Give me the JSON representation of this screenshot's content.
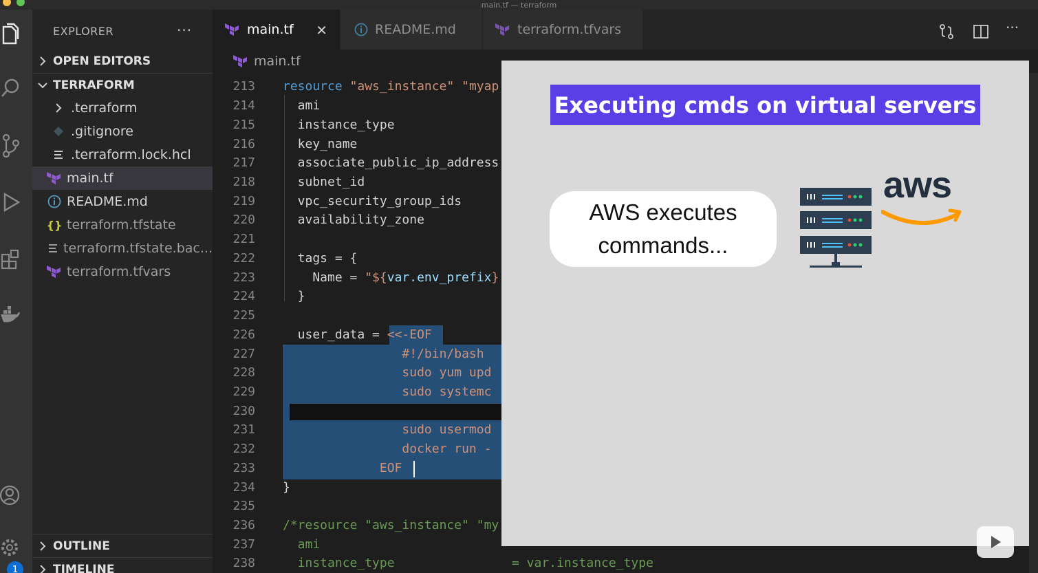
{
  "window": {
    "title": "main.tf — terraform"
  },
  "sidebar": {
    "header": "EXPLORER",
    "more": "···",
    "open_editors": "OPEN EDITORS",
    "folder": "TERRAFORM",
    "items": [
      {
        "label": ".terraform",
        "icon": "chevron-right-icon"
      },
      {
        "label": ".gitignore",
        "icon": "git-diamond-icon"
      },
      {
        "label": ".terraform.lock.hcl",
        "icon": "lines-icon"
      },
      {
        "label": "main.tf",
        "icon": "terraform-icon"
      },
      {
        "label": "README.md",
        "icon": "info-icon"
      },
      {
        "label": "terraform.tfstate",
        "icon": "braces-icon"
      },
      {
        "label": "terraform.tfstate.bac...",
        "icon": "lines-icon"
      },
      {
        "label": "terraform.tfvars",
        "icon": "terraform-icon"
      }
    ],
    "outline": "OUTLINE",
    "timeline": "TIMELINE"
  },
  "activity": {
    "badge_count": "1"
  },
  "tabs": [
    {
      "label": "main.tf",
      "active": true,
      "close": "✕"
    },
    {
      "label": "README.md",
      "active": false
    },
    {
      "label": "terraform.tfvars",
      "active": false
    }
  ],
  "breadcrumb": {
    "file": "main.tf"
  },
  "editor": {
    "line_numbers": [
      "213",
      "214",
      "215",
      "216",
      "217",
      "218",
      "219",
      "220",
      "221",
      "222",
      "223",
      "224",
      "225",
      "226",
      "227",
      "228",
      "229",
      "230",
      "231",
      "232",
      "233",
      "234",
      "235",
      "236",
      "237",
      "238"
    ],
    "lines": {
      "l213a": "resource",
      "l213b": "\"aws_instance\" \"myap",
      "l214": "  ami",
      "l215": "  instance_type",
      "l216": "  key_name",
      "l217": "  associate_public_ip_address",
      "l218": "  subnet_id",
      "l219": "  vpc_security_group_ids",
      "l220": "  availability_zone",
      "l222": "  tags = {",
      "l223a": "    Name = ",
      "l223b": "\"${",
      "l223c": "var.env_prefix",
      "l223d": "}",
      "l224": "  }",
      "l226a": "  user_data = ",
      "l226b": "<<-EOF",
      "l227": "                #!/bin/bash",
      "l228": "                sudo yum upd",
      "l229": "                sudo systemc",
      "l231": "                sudo usermod",
      "l232": "                docker run -",
      "l233": "             EOF",
      "l234": "}",
      "l236a": "/*resource \"aws_instance\" \"my",
      "l237": "  ami",
      "l238a": "  instance_type",
      "l238b": "= var.instance_type"
    }
  },
  "overlay": {
    "banner": "Executing cmds on virtual servers",
    "bubble_line1": "AWS executes",
    "bubble_line2": "commands...",
    "logo_text": "aws"
  },
  "colors": {
    "banner": "#5a3fe6",
    "aws_orange": "#f90",
    "server_dark": "#2c3e50"
  }
}
